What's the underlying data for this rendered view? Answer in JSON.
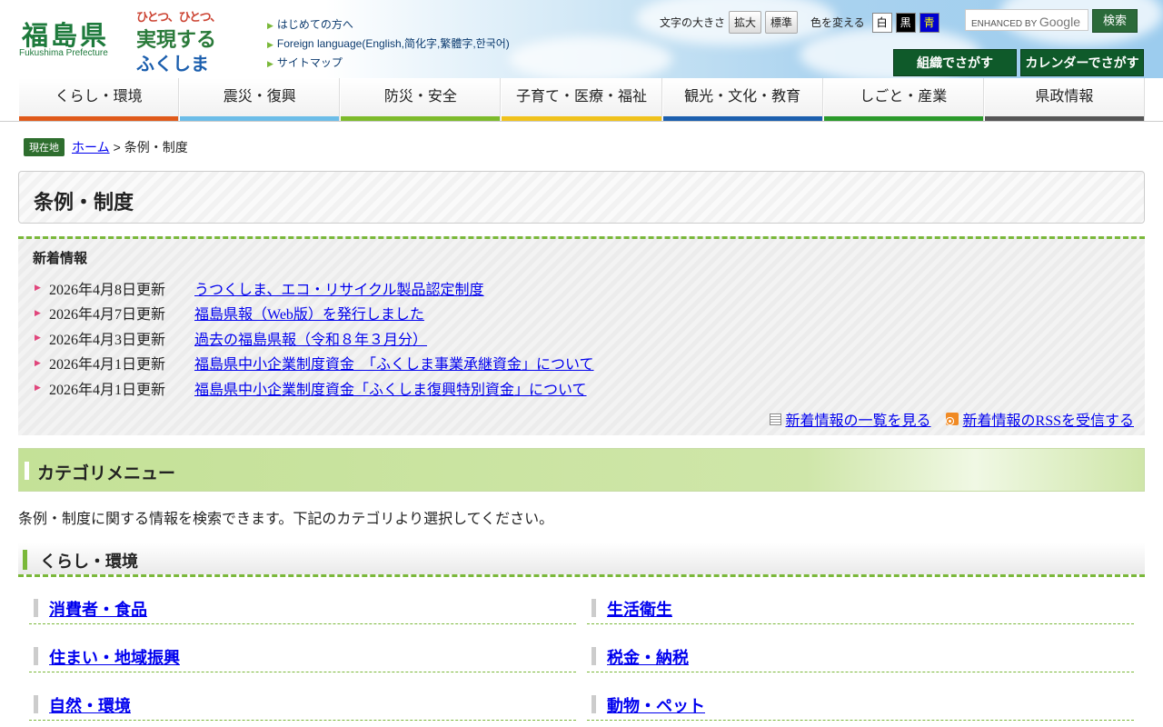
{
  "header": {
    "logo_kanji": "福島県",
    "logo_en": "Fukushima Prefecture",
    "slogan": [
      "ひとつ、ひとつ、",
      "実現する",
      "ふくしま"
    ],
    "links": [
      "はじめての方へ",
      "Foreign language(English,简化字,繁體字,한국어)",
      "サイトマップ"
    ],
    "font_size_label": "文字の大きさ",
    "enlarge": "拡大",
    "standard": "標準",
    "color_label": "色を変える",
    "color_white": "白",
    "color_black": "黒",
    "color_blue": "青",
    "search_placeholder": "ENHANCED BY",
    "search_google": "Google",
    "search_button": "検索",
    "find_by_org": "組織でさがす",
    "find_by_calendar": "カレンダーでさがす"
  },
  "gnav": [
    {
      "label": "くらし・環境",
      "color": "#e05a1a"
    },
    {
      "label": "震災・復興",
      "color": "#6cbde8"
    },
    {
      "label": "防災・安全",
      "color": "#7dbb2b"
    },
    {
      "label": "子育て・医療・福祉",
      "color": "#f0c21c"
    },
    {
      "label": "観光・文化・教育",
      "color": "#1c5fae"
    },
    {
      "label": "しごと・産業",
      "color": "#2a9a2a"
    },
    {
      "label": "県政情報",
      "color": "#555555"
    }
  ],
  "breadcrumb": {
    "here": "現在地",
    "home": "ホーム",
    "sep": ">",
    "current": "条例・制度"
  },
  "page_title": "条例・制度",
  "news": {
    "heading": "新着情報",
    "items": [
      {
        "date": "2026年4月8日更新",
        "title": "うつくしま、エコ・リサイクル製品認定制度"
      },
      {
        "date": "2026年4月7日更新",
        "title": "福島県報（Web版）を発行しました"
      },
      {
        "date": "2026年4月3日更新",
        "title": "過去の福島県報（令和８年３月分）"
      },
      {
        "date": "2026年4月1日更新",
        "title": "福島県中小企業制度資金　「ふくしま事業承継資金」について"
      },
      {
        "date": "2026年4月1日更新",
        "title": "福島県中小企業制度資金「ふくしま復興特別資金」について"
      }
    ],
    "view_all": "新着情報の一覧を見る",
    "rss": "新着情報のRSSを受信する"
  },
  "category": {
    "heading": "カテゴリメニュー",
    "intro": "条例・制度に関する情報を検索できます。下記のカテゴリより選択してください。",
    "section": "くらし・環境",
    "links": [
      "消費者・食品",
      "生活衛生",
      "住まい・地域振興",
      "税金・納税",
      "自然・環境",
      "動物・ペット"
    ]
  }
}
